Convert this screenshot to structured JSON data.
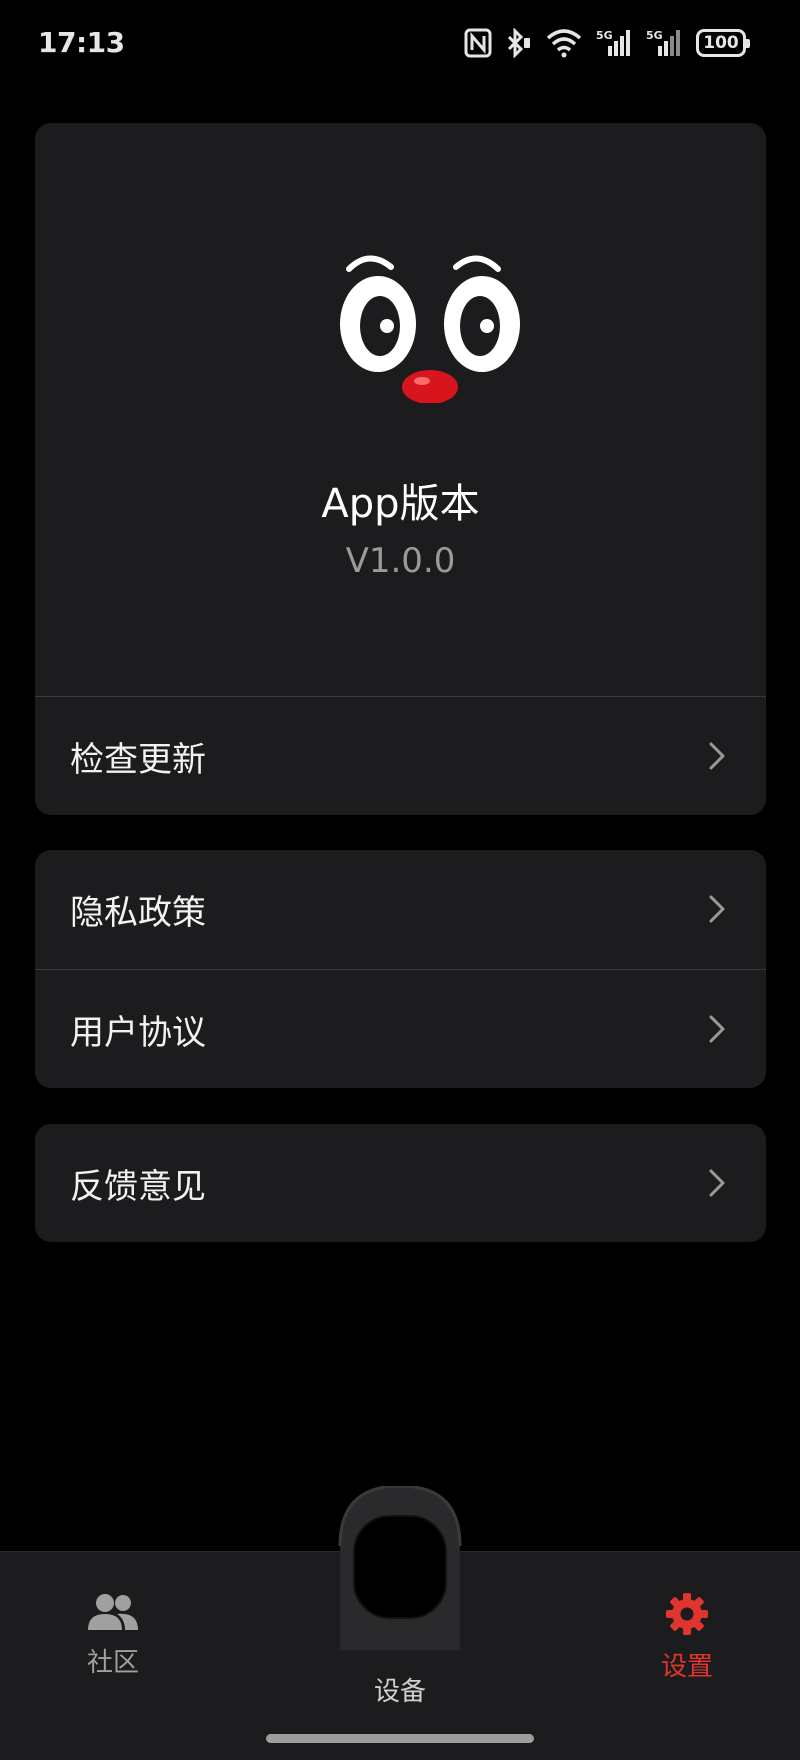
{
  "status_bar": {
    "time": "17:13",
    "network_label_1": "5G",
    "network_label_2": "5G",
    "battery": "100",
    "icons": [
      "nfc-icon",
      "bluetooth-icon",
      "wifi-icon",
      "signal-5g-icon",
      "signal-5g-icon",
      "battery-icon"
    ]
  },
  "about": {
    "mascot": "mascot-face-icon",
    "title": "App版本",
    "version": "V1.0.0"
  },
  "menu": {
    "check_update": "检查更新",
    "privacy_policy": "隐私政策",
    "user_agreement": "用户协议",
    "feedback": "反馈意见"
  },
  "bottom_nav": {
    "community": "社区",
    "device": "设备",
    "settings": "设置",
    "active": "settings"
  },
  "colors": {
    "accent": "#e0342e",
    "card_bg": "#1c1c1e",
    "page_bg": "#000000",
    "secondary_text": "#9a9a9a"
  }
}
